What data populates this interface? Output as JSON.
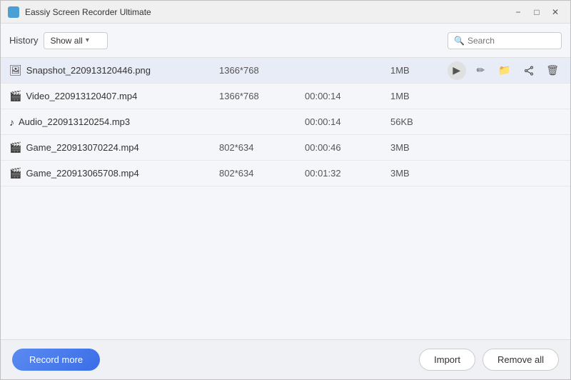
{
  "titleBar": {
    "title": "Eassiy Screen Recorder Ultimate",
    "controls": {
      "minimize": "−",
      "maximize": "□",
      "close": "✕"
    }
  },
  "toolbar": {
    "historyLabel": "History",
    "filterLabel": "Show all",
    "searchPlaceholder": "Search"
  },
  "records": [
    {
      "icon": "🖼",
      "name": "Snapshot_220913120446.png",
      "resolution": "1366*768",
      "duration": "",
      "size": "1MB",
      "selected": true
    },
    {
      "icon": "🎬",
      "name": "Video_220913120407.mp4",
      "resolution": "1366*768",
      "duration": "00:00:14",
      "size": "1MB",
      "selected": false
    },
    {
      "icon": "♪",
      "name": "Audio_220913120254.mp3",
      "resolution": "",
      "duration": "00:00:14",
      "size": "56KB",
      "selected": false
    },
    {
      "icon": "🎬",
      "name": "Game_220913070224.mp4",
      "resolution": "802*634",
      "duration": "00:00:46",
      "size": "3MB",
      "selected": false
    },
    {
      "icon": "🎬",
      "name": "Game_220913065708.mp4",
      "resolution": "802*634",
      "duration": "00:01:32",
      "size": "3MB",
      "selected": false
    }
  ],
  "actions": {
    "play": "▶",
    "edit": "✏",
    "folder": "📁",
    "share": "⟪",
    "delete": "🗑"
  },
  "footer": {
    "recordMore": "Record more",
    "import": "Import",
    "removeAll": "Remove all"
  }
}
